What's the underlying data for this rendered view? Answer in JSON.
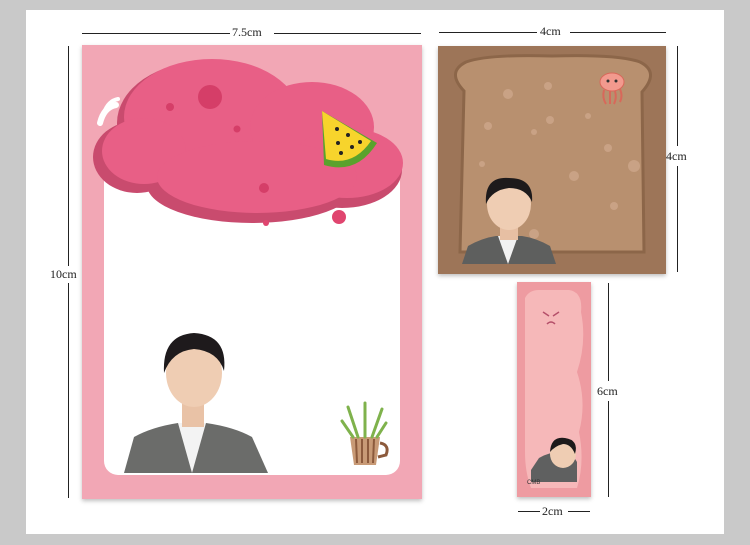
{
  "dimensions": {
    "large_width": "7.5cm",
    "large_height": "10cm",
    "square_width": "4cm",
    "square_height": "4cm",
    "strip_height": "6cm",
    "strip_width": "2cm"
  },
  "colors": {
    "background": "#c9c9c9",
    "card": "#ffffff",
    "large_pad": "#f2a7b5",
    "cloud": "#e85f86",
    "square_pad": "#9d7558",
    "toast": "#b8906f",
    "strip_pad": "#ee9ba1",
    "strip_inner": "#f6b8b9"
  },
  "illustrations": {
    "large_pad": [
      "cloud",
      "watermelon-slice-icon",
      "potted-plant-icon",
      "portrait-photo"
    ],
    "square_pad": [
      "toast-slice",
      "jellyfish-icon",
      "portrait-photo"
    ],
    "strip_pad": [
      "face-doodle-icon",
      "portrait-photo"
    ]
  }
}
